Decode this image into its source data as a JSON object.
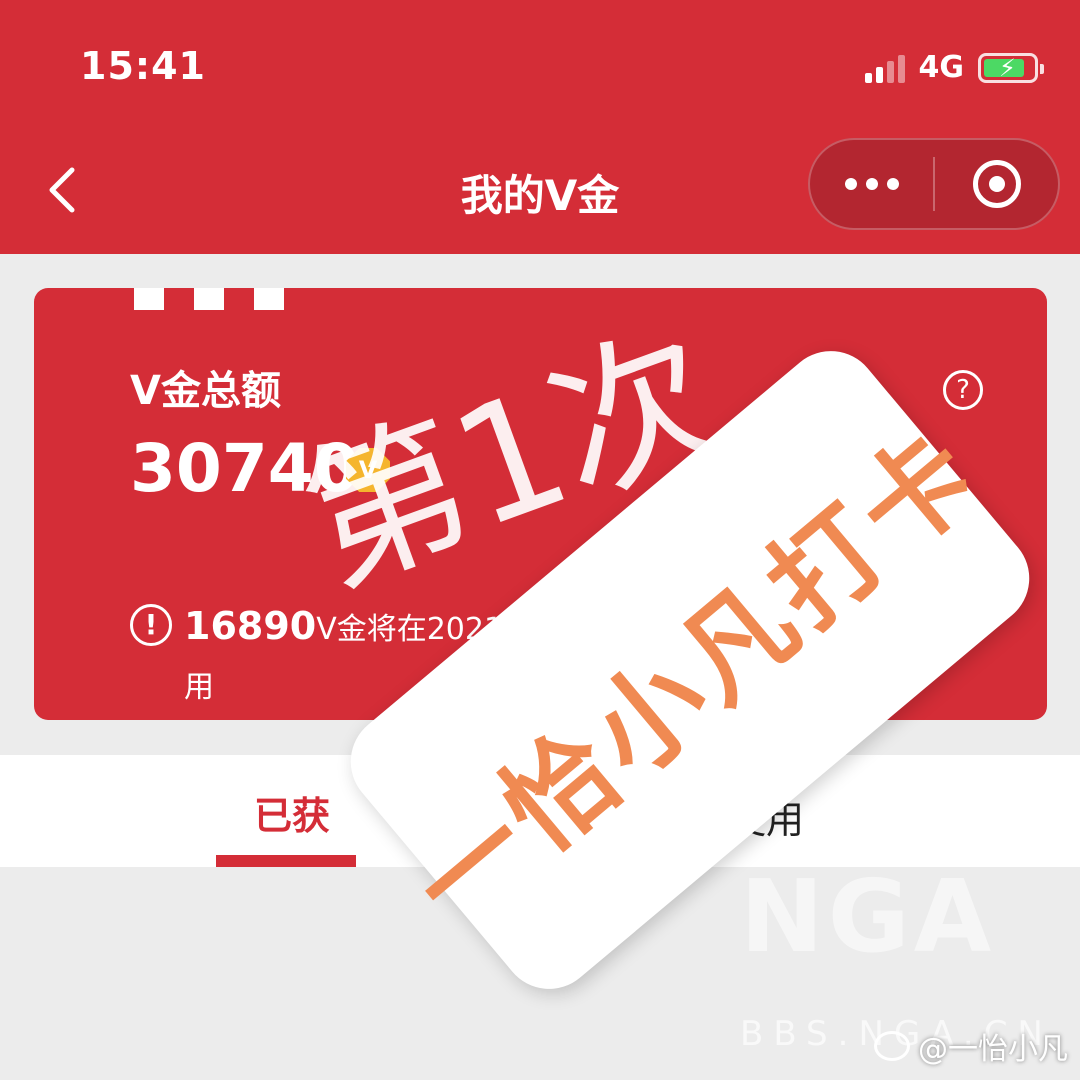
{
  "status": {
    "time": "15:41",
    "network": "4G"
  },
  "nav": {
    "title": "我的V金"
  },
  "card": {
    "label": "V金总额",
    "amount": "30740",
    "coin_letter": "V",
    "help": "?",
    "warn": "!",
    "expiring_amount": "16890",
    "notice_text": "V金将在2021年1",
    "notice_line2": "用"
  },
  "tabs": {
    "earned": "已获",
    "used": "已使用"
  },
  "overlay": {
    "stamp": "第1次",
    "sticker": "一恰小凡打卡"
  },
  "watermark": {
    "nga": "NGA",
    "bbs": "BBS.NGA.CN"
  },
  "weibo": {
    "handle": "@一怡小凡"
  },
  "colors": {
    "brand_red": "#d42d37",
    "sticker_orange": "#f08a52",
    "coin_gold": "#f5b52d"
  }
}
